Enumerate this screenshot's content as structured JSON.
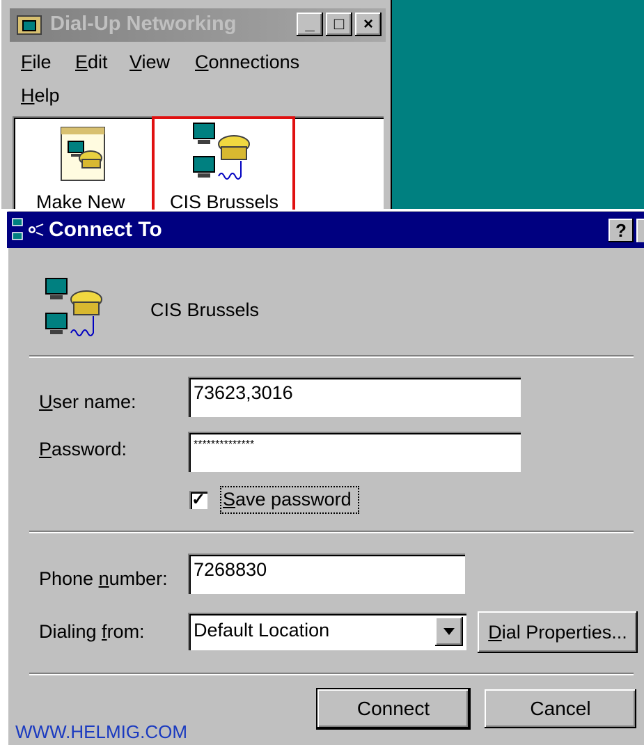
{
  "back_window": {
    "title": "Dial-Up Networking",
    "controls": {
      "minimize": "_",
      "maximize": "□",
      "close": "×"
    },
    "menu": [
      {
        "label": "File",
        "underline": "F",
        "rest": "ile"
      },
      {
        "label": "Edit",
        "underline": "E",
        "rest": "dit"
      },
      {
        "label": "View",
        "underline": "V",
        "rest": "iew"
      },
      {
        "label": "Connections",
        "underline": "C",
        "rest": "onnections"
      },
      {
        "label": "Help",
        "underline": "H",
        "rest": "elp"
      }
    ],
    "items": [
      {
        "label": "Make New",
        "icon": "make-new-connection-icon"
      },
      {
        "label": "CIS Brussels",
        "icon": "dialup-connection-icon",
        "selected": true
      }
    ]
  },
  "dialog": {
    "title": "Connect To",
    "help_button": "?",
    "connection_name": "CIS Brussels",
    "username_label": {
      "underline": "U",
      "rest": "ser name:"
    },
    "username_value": "73623,3016",
    "password_label": {
      "underline": "P",
      "rest": "assword:"
    },
    "password_value": "**************",
    "save_password": {
      "checked": true,
      "mark": "✓",
      "underline": "S",
      "rest": "ave password"
    },
    "phone_label": {
      "pre": "Phone ",
      "underline": "n",
      "rest": "umber:"
    },
    "phone_value": "7268830",
    "dialing_label": {
      "pre": "Dialing ",
      "underline": "f",
      "rest": "rom:"
    },
    "dialing_value": "Default Location",
    "dial_properties": {
      "underline": "D",
      "rest": "ial Properties..."
    },
    "connect": "Connect",
    "cancel": "Cancel"
  },
  "watermark": "WWW.HELMIG.COM",
  "colors": {
    "desktop": "#008080",
    "titlebar_active": "#000080",
    "highlight": "#e01010",
    "watermark": "#1a3ac0"
  }
}
